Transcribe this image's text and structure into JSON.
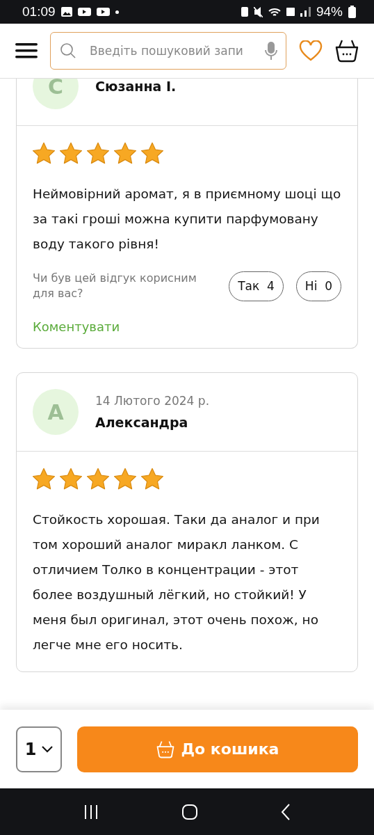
{
  "status_bar": {
    "time": "01:09",
    "battery": "94%"
  },
  "header": {
    "search": {
      "placeholder": "Введіть пошуковий запи"
    }
  },
  "reviews": [
    {
      "avatar_letter": "С",
      "name": "Сюзанна І.",
      "stars": 5,
      "text": "Неймовірний аромат, я в приємному шоці що за такі гроші можна купити парфумовану воду такого рівня!",
      "helpful": {
        "question": "Чи був цей відгук корисним для вас?",
        "yes_label": "Так",
        "yes_count": "4",
        "no_label": "Ні",
        "no_count": "0"
      },
      "comment_link": "Коментувати"
    },
    {
      "avatar_letter": "А",
      "date": "14 Лютого 2024 р.",
      "name": "Александра",
      "stars": 5,
      "text": "Стойкость хорошая. Таки да аналог и при том хороший аналог миракл ланком. С отличием Толко в концентрации - этот более воздушный лёгкий, но стойкий! У меня был оригинал, этот очень похож, но легче мне его носить."
    }
  ],
  "bottom_bar": {
    "quantity": "1",
    "add_button": "До кошика"
  }
}
